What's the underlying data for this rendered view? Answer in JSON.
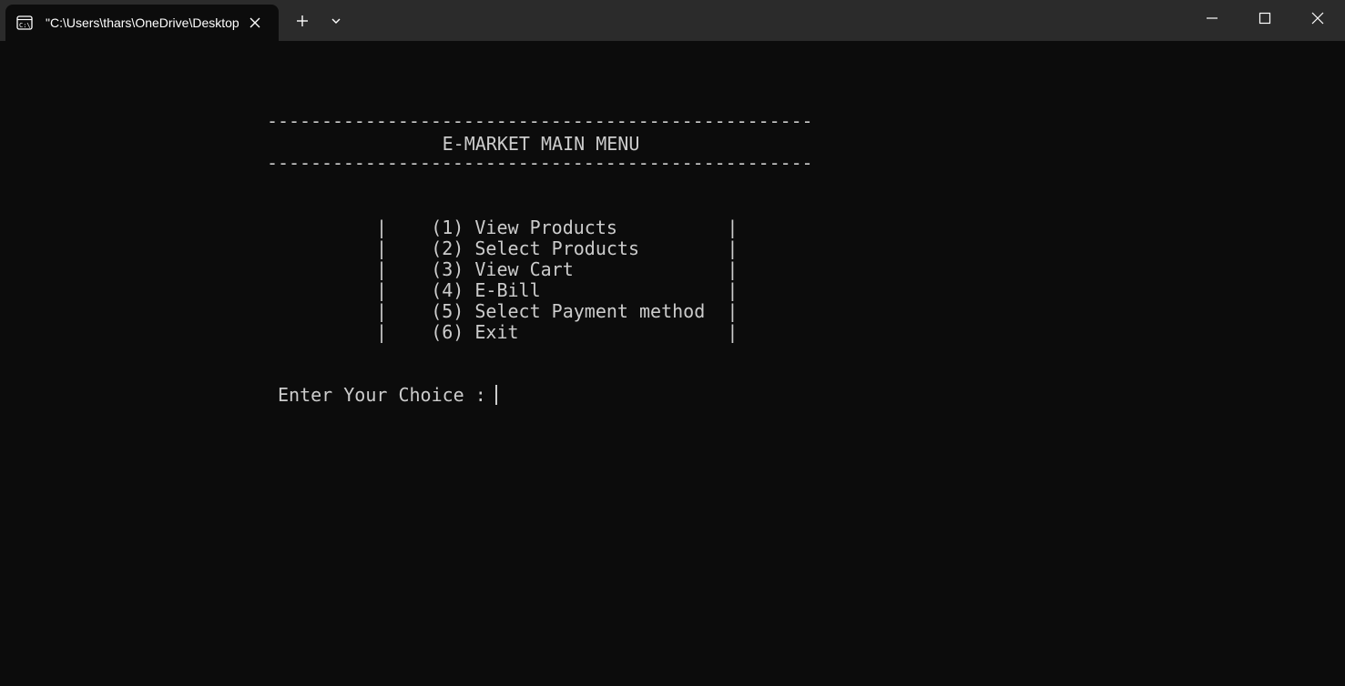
{
  "window": {
    "tab_title": "\"C:\\Users\\thars\\OneDrive\\Desktop",
    "icons": {
      "tab": "console-icon",
      "tab_close": "close-icon",
      "new_tab": "plus-icon",
      "dropdown": "chevron-down-icon",
      "minimize": "minimize-icon",
      "maximize": "maximize-icon",
      "close": "close-icon"
    }
  },
  "console": {
    "separator": "--------------------------------------------------",
    "title": "               E-MARKET MAIN MENU",
    "menu": [
      "|    (1) View Products          |",
      "|    (2) Select Products        |",
      "|    (3) View Cart              |",
      "|    (4) E-Bill                 |",
      "|    (5) Select Payment method  |",
      "|    (6) Exit                   |"
    ],
    "prompt": "Enter Your Choice : "
  },
  "colors": {
    "background": "#0c0c0c",
    "titlebar": "#2b2b2b",
    "text": "#cccccc"
  }
}
